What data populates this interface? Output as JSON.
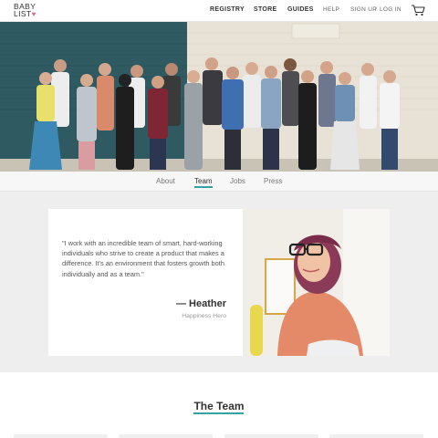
{
  "header": {
    "logo_line1": "BABY",
    "logo_line2": "LIST",
    "logo_heart": "♥",
    "nav": {
      "registry": "REGISTRY",
      "store": "STORE",
      "guides": "GUIDES",
      "help": "HELP",
      "signup": "SIGN UP",
      "separator": "/",
      "login": "LOG IN"
    },
    "cart_icon": "cart-icon"
  },
  "tabs": {
    "items": [
      "About",
      "Team",
      "Jobs",
      "Press"
    ],
    "active": "Team"
  },
  "testimonial": {
    "quote": "\"I work with an incredible team of smart, hard-working individuals who strive to create a product that makes a difference. It's an environment that fosters growth both individually and as a team.\"",
    "author": "— Heather",
    "role": "Happiness Hero"
  },
  "team": {
    "title": "The Team"
  },
  "colors": {
    "accent": "#35a3a2",
    "heart": "#e36b7d",
    "hero_wall_left": "#2f5a62",
    "hero_wall_right": "#e8e2d6"
  }
}
